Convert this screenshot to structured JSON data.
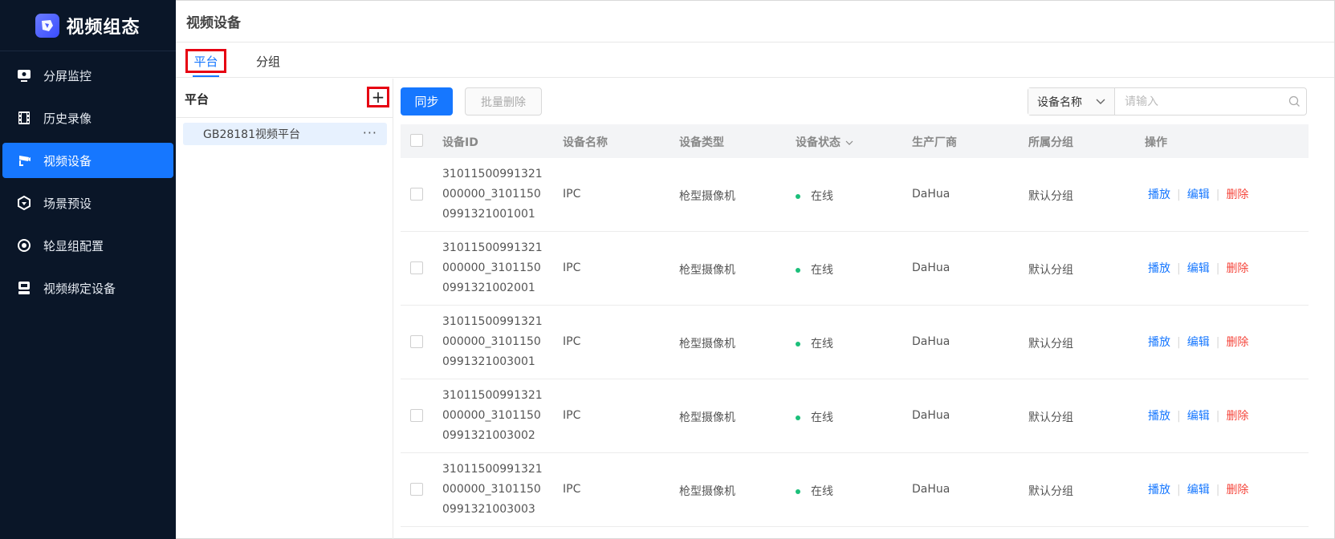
{
  "app": {
    "title": "视频组态",
    "brand_color": "#1677ff"
  },
  "sidebar": {
    "items": [
      {
        "label": "分屏监控",
        "icon": "monitor-icon",
        "active": false
      },
      {
        "label": "历史录像",
        "icon": "film-icon",
        "active": false
      },
      {
        "label": "视频设备",
        "icon": "camera-icon",
        "active": true
      },
      {
        "label": "场景预设",
        "icon": "scene-icon",
        "active": false
      },
      {
        "label": "轮显组配置",
        "icon": "cycle-icon",
        "active": false
      },
      {
        "label": "视频绑定设备",
        "icon": "device-bind-icon",
        "active": false
      }
    ]
  },
  "header": {
    "title": "视频设备"
  },
  "tabs": [
    {
      "label": "平台",
      "active": true
    },
    {
      "label": "分组",
      "active": false
    }
  ],
  "left_panel": {
    "title": "平台",
    "add_symbol": "+",
    "items": [
      {
        "label": "GB28181视频平台",
        "more": "···"
      }
    ]
  },
  "toolbar": {
    "sync_label": "同步",
    "batch_delete_label": "批量删除",
    "search_field": "设备名称",
    "search_placeholder": "请输入"
  },
  "table": {
    "columns": [
      "设备ID",
      "设备名称",
      "设备类型",
      "设备状态",
      "生产厂商",
      "所属分组",
      "操作"
    ],
    "rows": [
      {
        "id": "31011500991321000000_31011500991321001001",
        "name": "IPC",
        "type": "枪型摄像机",
        "status": "在线",
        "vendor": "DaHua",
        "group": "默认分组"
      },
      {
        "id": "31011500991321000000_31011500991321002001",
        "name": "IPC",
        "type": "枪型摄像机",
        "status": "在线",
        "vendor": "DaHua",
        "group": "默认分组"
      },
      {
        "id": "31011500991321000000_31011500991321003001",
        "name": "IPC",
        "type": "枪型摄像机",
        "status": "在线",
        "vendor": "DaHua",
        "group": "默认分组"
      },
      {
        "id": "31011500991321000000_31011500991321003002",
        "name": "IPC",
        "type": "枪型摄像机",
        "status": "在线",
        "vendor": "DaHua",
        "group": "默认分组"
      },
      {
        "id": "31011500991321000000_31011500991321003003",
        "name": "IPC",
        "type": "枪型摄像机",
        "status": "在线",
        "vendor": "DaHua",
        "group": "默认分组"
      }
    ],
    "actions": {
      "play": "播放",
      "edit": "编辑",
      "delete": "删除",
      "separator": "|"
    },
    "status_color": "#1bbf7a",
    "delete_color": "#f5473d"
  }
}
